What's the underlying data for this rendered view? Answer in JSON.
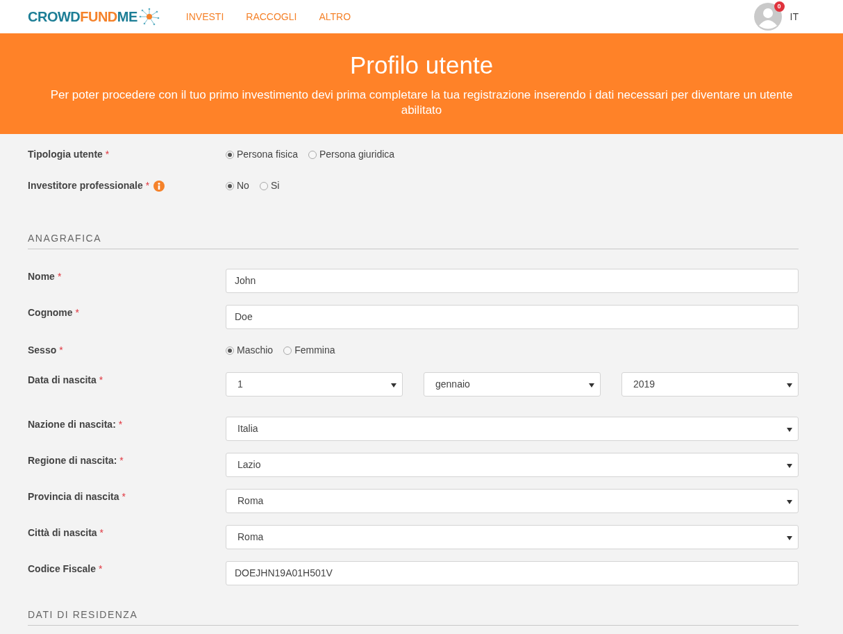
{
  "header": {
    "logo": [
      {
        "text": "CROWD",
        "color": "#1d7e96"
      },
      {
        "text": "FUND",
        "color": "#f5822a"
      },
      {
        "text": "ME",
        "color": "#1d7e96"
      }
    ],
    "nav": [
      {
        "label": "INVESTI"
      },
      {
        "label": "RACCOGLI"
      },
      {
        "label": "ALTRO"
      }
    ],
    "notifications_badge": "0",
    "language": "IT"
  },
  "banner": {
    "title": "Profilo utente",
    "subtitle": "Per poter procedere con il tuo primo investimento devi prima completare la tua registrazione inserendo i dati necessari per diventare un utente abilitato"
  },
  "top_fields": [
    {
      "kind": "radio",
      "label": "Tipologia utente",
      "required_mark": "*",
      "info": false,
      "options": [
        {
          "label": "Persona fisica",
          "selected": true
        },
        {
          "label": "Persona giuridica",
          "selected": false
        }
      ]
    },
    {
      "kind": "radio",
      "label": "Investitore professionale",
      "required_mark": "*",
      "info": true,
      "options": [
        {
          "label": "No",
          "selected": true
        },
        {
          "label": "Si",
          "selected": false
        }
      ]
    }
  ],
  "sections": [
    {
      "title": "ANAGRAFICA",
      "fields": [
        {
          "kind": "text",
          "label": "Nome",
          "required_mark": "*",
          "value": "John"
        },
        {
          "kind": "text",
          "label": "Cognome",
          "required_mark": "*",
          "value": "Doe"
        },
        {
          "kind": "radio",
          "label": "Sesso",
          "required_mark": "*",
          "options": [
            {
              "label": "Maschio",
              "selected": true
            },
            {
              "label": "Femmina",
              "selected": false
            }
          ]
        },
        {
          "kind": "date",
          "label": "Data di nascita",
          "required_mark": "*",
          "values": [
            "1",
            "gennaio",
            "2019"
          ]
        },
        {
          "kind": "select",
          "label": "Nazione di nascita:",
          "required_mark": "*",
          "value": "Italia"
        },
        {
          "kind": "select",
          "label": "Regione di nascita:",
          "required_mark": "*",
          "value": "Lazio"
        },
        {
          "kind": "select",
          "label": "Provincia di nascita",
          "required_mark": "*",
          "value": "Roma"
        },
        {
          "kind": "select",
          "label": "Città di nascita",
          "required_mark": "*",
          "value": "Roma"
        },
        {
          "kind": "text",
          "label": "Codice Fiscale",
          "required_mark": "*",
          "value": "DOEJHN19A01H501V"
        }
      ]
    },
    {
      "title": "DATI DI RESIDENZA"
    }
  ]
}
